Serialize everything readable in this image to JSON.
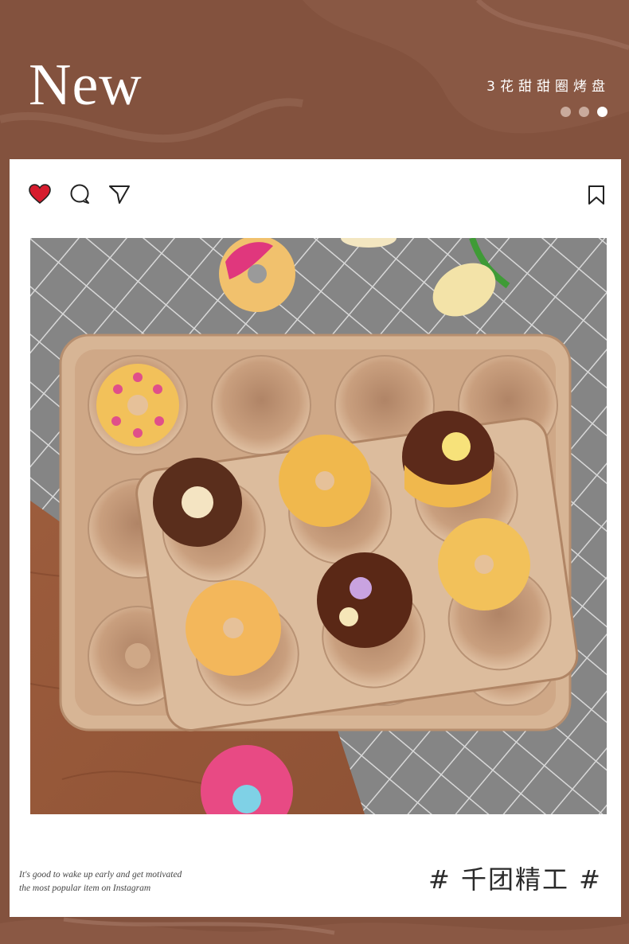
{
  "header": {
    "title": "New",
    "subtitle": "3花甜甜圈烤盘",
    "pager": {
      "count": 3,
      "active_index": 2
    }
  },
  "card": {
    "actions": [
      {
        "icon": "heart-icon",
        "label": "like"
      },
      {
        "icon": "comment-icon",
        "label": "comment"
      },
      {
        "icon": "share-icon",
        "label": "share"
      }
    ],
    "bookmark_icon": "bookmark-icon",
    "photo_alt": "donut baking pans with donuts",
    "caption_line1": "It's good to wake up early and get motivated",
    "caption_line2": "the most popular item on Instagram",
    "brand_tag": "# 千团精工 #"
  },
  "colors": {
    "background": "#83523e",
    "heart": "#d61c2e",
    "pan": "#cfa887",
    "tablecloth": "#8a8a8a",
    "wood": "#9b5b3c"
  }
}
